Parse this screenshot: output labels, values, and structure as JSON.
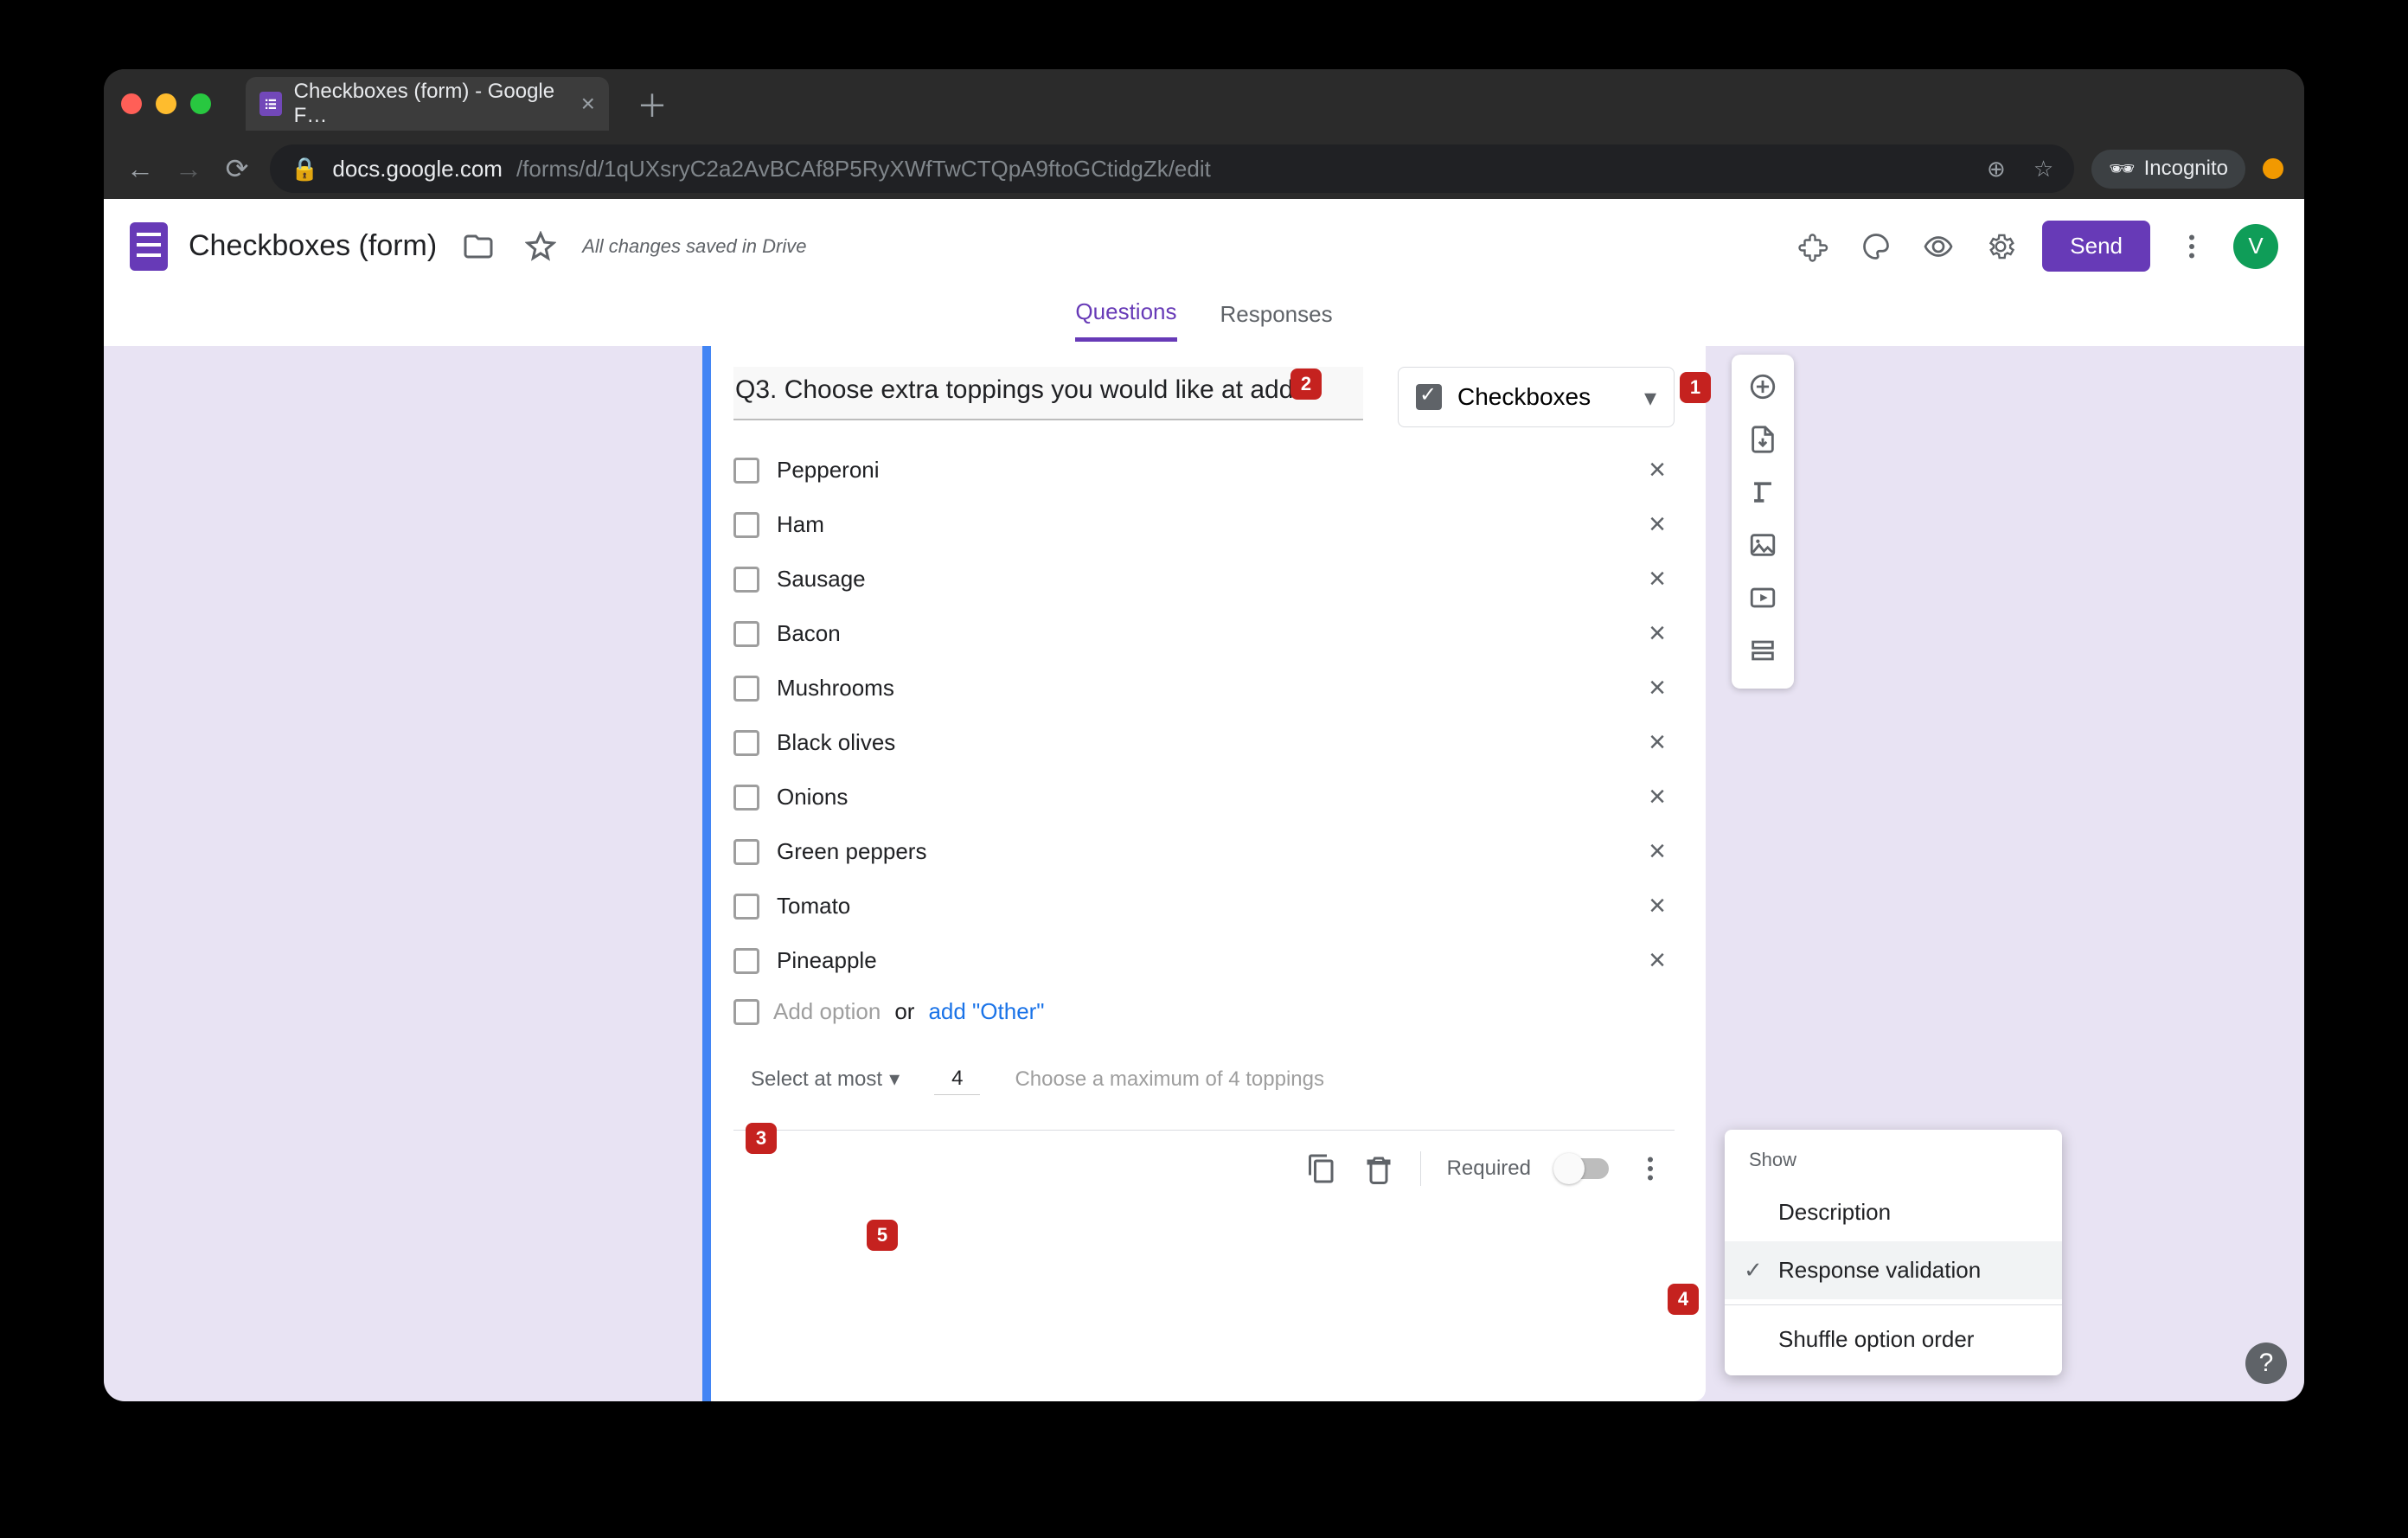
{
  "browser": {
    "tab_title": "Checkboxes (form) - Google F…",
    "url_host": "docs.google.com",
    "url_path": "/forms/d/1qUXsryC2a2AvBCAf8P5RyXWfTwCTQpA9ftoGCtidgZk/edit",
    "incognito_label": "Incognito"
  },
  "header": {
    "doc_title": "Checkboxes (form)",
    "save_status": "All changes saved in Drive",
    "send_label": "Send",
    "avatar_letter": "V"
  },
  "tabs": {
    "questions": "Questions",
    "responses": "Responses"
  },
  "question": {
    "title": "Q3. Choose extra toppings you would like at add",
    "type_label": "Checkboxes",
    "options": [
      "Pepperoni",
      "Ham",
      "Sausage",
      "Bacon",
      "Mushrooms",
      "Black olives",
      "Onions",
      "Green peppers",
      "Tomato",
      "Pineapple"
    ],
    "add_option": "Add option",
    "or": "or",
    "add_other": "add \"Other\"",
    "validation": {
      "rule": "Select at most",
      "number": "4",
      "message": "Choose a maximum of 4 toppings"
    },
    "required_label": "Required"
  },
  "popup": {
    "show": "Show",
    "description": "Description",
    "response_validation": "Response validation",
    "shuffle": "Shuffle option order"
  },
  "badges": [
    "1",
    "2",
    "3",
    "4",
    "5"
  ]
}
